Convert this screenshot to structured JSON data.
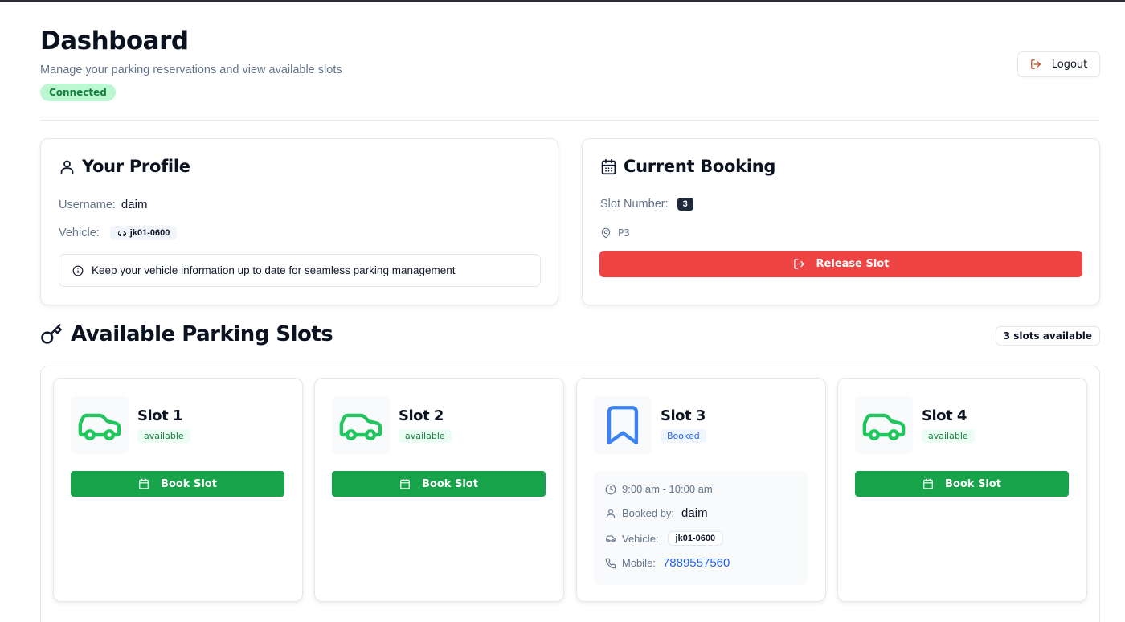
{
  "header": {
    "title": "Dashboard",
    "subtitle": "Manage your parking reservations and view available slots",
    "connection_status": "Connected",
    "logout_label": "Logout"
  },
  "profile": {
    "title": "Your Profile",
    "username_label": "Username:",
    "username": "daim",
    "vehicle_label": "Vehicle:",
    "vehicle": "jk01-0600",
    "note": "Keep your vehicle information up to date for seamless parking management"
  },
  "booking": {
    "title": "Current Booking",
    "slot_number_label": "Slot Number:",
    "slot_number": "3",
    "location": "P3",
    "release_label": "Release Slot"
  },
  "slots_section": {
    "title": "Available Parking Slots",
    "available_count": "3 slots available"
  },
  "slots": [
    {
      "name": "Slot 1",
      "status": "available",
      "button_label": "Book Slot"
    },
    {
      "name": "Slot 2",
      "status": "available",
      "button_label": "Book Slot"
    },
    {
      "name": "Slot 3",
      "status": "Booked",
      "time": "9:00 am - 10:00 am",
      "booked_by_label": "Booked by:",
      "booked_by": "daim",
      "vehicle_label": "Vehicle:",
      "vehicle": "jk01-0600",
      "mobile_label": "Mobile:",
      "mobile": "7889557560"
    },
    {
      "name": "Slot 4",
      "status": "available",
      "button_label": "Book Slot"
    }
  ],
  "colors": {
    "available_green": "#16a34a",
    "booked_blue": "#3b82f6",
    "release_red": "#ef4444",
    "connected_bg": "#bbf7d0"
  }
}
